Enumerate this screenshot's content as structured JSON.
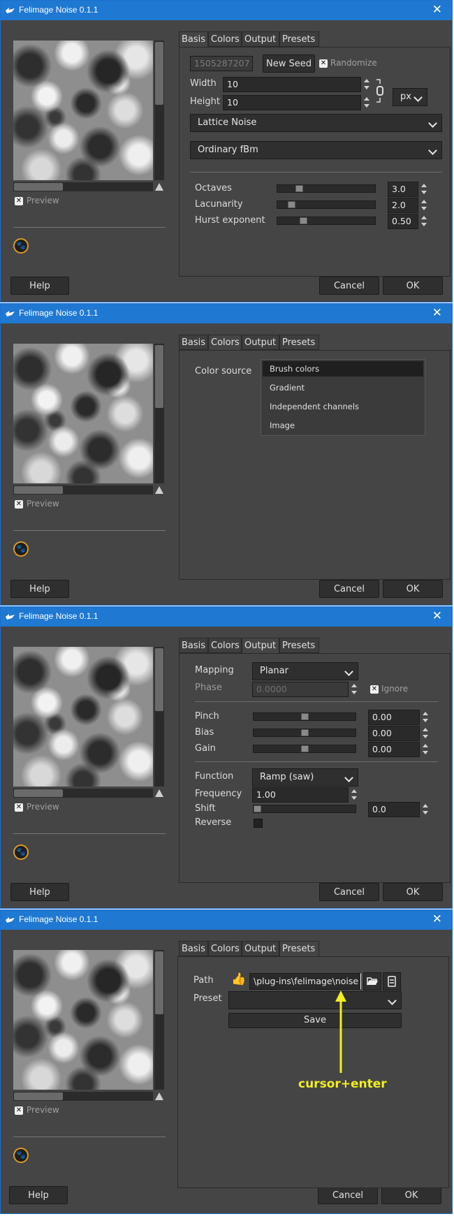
{
  "app_title": "Felimage Noise 0.1.1",
  "common": {
    "preview_label": "Preview",
    "help_label": "Help",
    "cancel_label": "Cancel",
    "ok_label": "OK"
  },
  "tabs": [
    "Basis",
    "Colors",
    "Output",
    "Presets"
  ],
  "basis": {
    "seed_value": "1505287207",
    "new_seed_label": "New Seed",
    "randomize_label": "Randomize",
    "width_label": "Width",
    "width_value": "10",
    "height_label": "Height",
    "height_value": "10",
    "unit": "px",
    "noise_type": "Lattice Noise",
    "fbm_type": "Ordinary fBm",
    "octaves_label": "Octaves",
    "octaves_value": "3.0",
    "octaves_level": 0.2,
    "lacunarity_label": "Lacunarity",
    "lacunarity_value": "2.0",
    "lacunarity_level": 0.12,
    "hurst_label": "Hurst exponent",
    "hurst_value": "0.50",
    "hurst_level": 0.25
  },
  "colors": {
    "color_source_label": "Color source",
    "options": [
      "Brush colors",
      "Gradient",
      "Independent channels",
      "Image"
    ],
    "selected": "Brush colors"
  },
  "output": {
    "mapping_label": "Mapping",
    "mapping_value": "Planar",
    "phase_label": "Phase",
    "phase_value": "0.0000",
    "ignore_label": "Ignore",
    "pinch_label": "Pinch",
    "pinch_value": "0.00",
    "bias_label": "Bias",
    "bias_value": "0.00",
    "gain_label": "Gain",
    "gain_value": "0.00",
    "center_level": 0.5,
    "function_label": "Function",
    "function_value": "Ramp (saw)",
    "frequency_label": "Frequency",
    "frequency_value": "1.00",
    "shift_label": "Shift",
    "shift_value": "0.0",
    "shift_level": 0.0,
    "reverse_label": "Reverse"
  },
  "presets": {
    "path_label": "Path",
    "path_value": "\\plug-ins\\felimage\\noise",
    "preset_label": "Preset",
    "preset_value": "",
    "save_label": "Save",
    "annotation": "cursor+enter"
  },
  "colors_theme": {
    "titlebar": "#1f78d1",
    "window_bg": "#454545",
    "annotation": "#f2ee22"
  }
}
